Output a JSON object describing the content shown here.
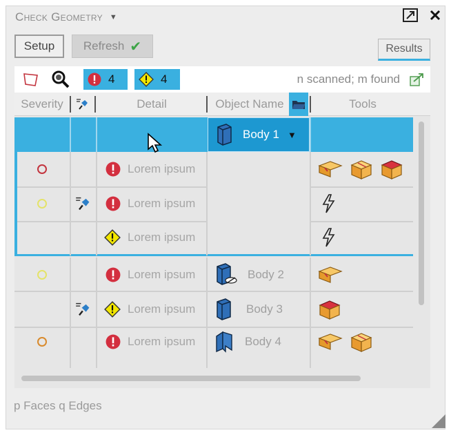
{
  "panel": {
    "title": "Check Geometry",
    "setup_label": "Setup",
    "refresh_label": "Refresh",
    "results_label": "Results"
  },
  "toolbar": {
    "error_count": "4",
    "warning_count": "4",
    "status": "n scanned; m found"
  },
  "columns": {
    "severity": "Severity",
    "detail": "Detail",
    "object_name": "Object Name",
    "tools": "Tools"
  },
  "rows": [
    {
      "detail": "Lorem ipsum"
    },
    {
      "detail": "Lorem ipsum"
    },
    {
      "detail": "Lorem ipsum"
    },
    {
      "detail": "Lorem ipsum"
    },
    {
      "detail": "Lorem ipsum"
    },
    {
      "detail": "Lorem ipsum"
    }
  ],
  "bodies": {
    "selected": "Body 1",
    "b2": "Body 2",
    "b3": "Body 3",
    "b4": "Body 4"
  },
  "footer": "p Faces q Edges",
  "colors": {
    "accent": "#3ab0e0",
    "error": "#d32f3f",
    "warning": "#f2e600",
    "severity_error": "#c3343e",
    "severity_warning": "#e4e36a",
    "severity_orange": "#d98a2c"
  },
  "icons": [
    "expand-arrow-icon",
    "close-icon",
    "checkmark-icon",
    "face-outline-icon",
    "magnifier-icon",
    "error-icon",
    "warning-icon",
    "export-icon",
    "pushpin-icon",
    "folder-icon",
    "body-box-icon",
    "hidden-body-icon",
    "sheet-body-icon",
    "tool-cube-icon",
    "lightning-icon",
    "cursor-icon"
  ]
}
